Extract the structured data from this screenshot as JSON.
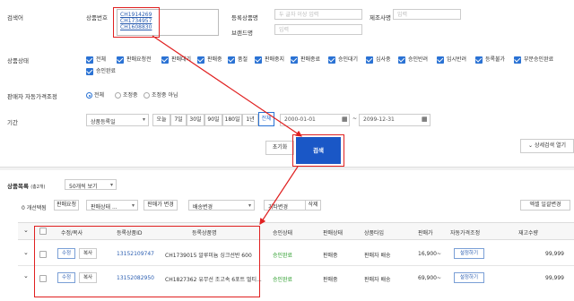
{
  "search": {
    "section_label": "검색어",
    "product_no_label": "상품번호",
    "product_codes": [
      "CH1914269",
      "CH1734957",
      "CH1608830"
    ],
    "reg_product_name_label": "등록상품명",
    "reg_product_name_placeholder": "두 글자 이상 입력",
    "manufacturer_label": "제조사명",
    "manufacturer_placeholder": "입력",
    "brand_label": "브랜드명",
    "brand_placeholder": "입력"
  },
  "status": {
    "label": "상품상태",
    "items": [
      "전체",
      "판매요청전",
      "판매대기",
      "판매중",
      "품절",
      "판매중지",
      "판매종료",
      "승인대기",
      "심사중",
      "승인반려",
      "임시반려",
      "등록불가",
      "부분승인완료",
      "승인완료"
    ]
  },
  "price_adjust": {
    "label": "판매자 자동가격조정",
    "options": [
      "전체",
      "조정중",
      "조정중 아님"
    ]
  },
  "period": {
    "label": "기간",
    "date_type": "상품등록일",
    "presets": [
      "오늘",
      "7일",
      "30일",
      "90일",
      "180일",
      "1년",
      "전체"
    ],
    "start_date": "2000-01-01",
    "end_date": "2099-12-31"
  },
  "actions": {
    "reset": "초기화",
    "search": "검색",
    "detail_toggle": "상세검색 열기"
  },
  "list": {
    "title": "상품목록",
    "count": "(총2개)",
    "page_size": "50개씩 보기",
    "selected": "0 개선택됨",
    "toolbar": [
      "판매요청",
      "판매상태 ...",
      "판매가 변경",
      "배송변경",
      "기타변경",
      "삭제"
    ],
    "excel": "엑셀 일괄변경",
    "headers": [
      "수정/복사",
      "등록상품ID",
      "등록상품명",
      "승인상태",
      "판매상태",
      "상품타입",
      "판매가",
      "자동가격조정",
      "재고수량"
    ],
    "rows": [
      {
        "edit": "수정",
        "copy": "복사",
        "id": "13152109747",
        "name": "CH1739015 알루미늄 싱크선반 600",
        "approval": "승인완료",
        "sale": "판매중",
        "type": "판매자 배송",
        "price": "16,900~",
        "auto": "설정하기",
        "stock": "99,999"
      },
      {
        "edit": "수정",
        "copy": "복사",
        "id": "13152082950",
        "name": "CH1827362 유무선 조고속 6포트 멀티...",
        "approval": "승인완료",
        "sale": "판매중",
        "type": "판매자 배송",
        "price": "69,900~",
        "auto": "설정하기",
        "stock": "99,999"
      }
    ]
  }
}
